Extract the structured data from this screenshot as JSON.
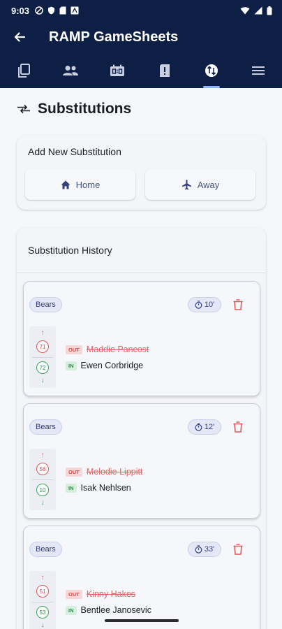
{
  "status_bar": {
    "time": "9:03"
  },
  "app_bar": {
    "title": "RAMP GameSheets"
  },
  "page": {
    "title": "Substitutions"
  },
  "add_section": {
    "label": "Add New Substitution",
    "home_label": "Home",
    "away_label": "Away"
  },
  "history": {
    "label": "Substitution History",
    "entries": [
      {
        "team": "Bears",
        "time": "10'",
        "out_number": "71",
        "out_tag": "OUT",
        "out_name": "Maddie Pancost",
        "in_number": "72",
        "in_tag": "IN",
        "in_name": "Ewen Corbridge"
      },
      {
        "team": "Bears",
        "time": "12'",
        "out_number": "56",
        "out_tag": "OUT",
        "out_name": "Melodie Lippitt",
        "in_number": "10",
        "in_tag": "IN",
        "in_name": "Isak Nehlsen"
      },
      {
        "team": "Bears",
        "time": "33'",
        "out_number": "51",
        "out_tag": "OUT",
        "out_name": "Kinny Hakes",
        "in_number": "53",
        "in_tag": "IN",
        "in_name": "Bentlee Janosevic"
      }
    ]
  },
  "colors": {
    "header": "#0e1f45",
    "out": "#e05a5a",
    "in": "#3ba55c",
    "chip": "#e3e7f6"
  }
}
